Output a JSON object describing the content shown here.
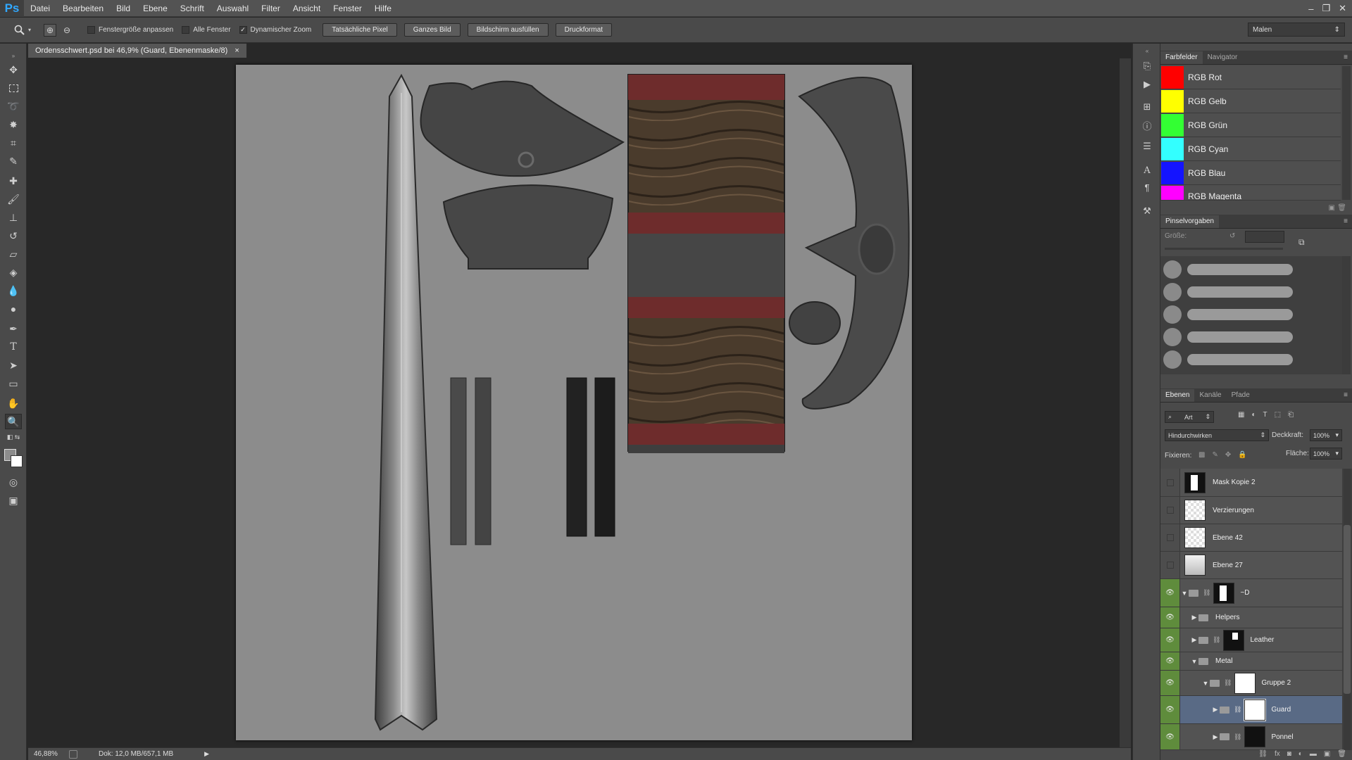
{
  "app": {
    "logo": "Ps"
  },
  "menu": [
    "Datei",
    "Bearbeiten",
    "Bild",
    "Ebene",
    "Schrift",
    "Auswahl",
    "Filter",
    "Ansicht",
    "Fenster",
    "Hilfe"
  ],
  "window_controls": {
    "minimize": "–",
    "restore": "❐",
    "close": "✕"
  },
  "options": {
    "fit_window": "Fenstergröße anpassen",
    "fit_window_checked": false,
    "all_windows": "Alle Fenster",
    "all_windows_checked": false,
    "dynamic_zoom": "Dynamischer Zoom",
    "dynamic_zoom_checked": true,
    "btn_actual": "Tatsächliche Pixel",
    "btn_fit": "Ganzes Bild",
    "btn_fill": "Bildschirm ausfüllen",
    "btn_print": "Druckformat",
    "workspace": "Malen"
  },
  "document": {
    "tab_title": "Ordensschwert.psd bei 46,9% (Guard, Ebenenmaske/8)",
    "close": "×"
  },
  "status": {
    "zoom": "46,88%",
    "doc": "Dok: 12,0 MB/657,1 MB"
  },
  "swatches_panel": {
    "tabs": [
      "Farbfelder",
      "Navigator"
    ],
    "items": [
      {
        "name": "RGB Rot",
        "color": "#ff0000"
      },
      {
        "name": "RGB Gelb",
        "color": "#ffff00"
      },
      {
        "name": "RGB Grün",
        "color": "#33ff33"
      },
      {
        "name": "RGB Cyan",
        "color": "#33ffff"
      },
      {
        "name": "RGB Blau",
        "color": "#1414ff"
      },
      {
        "name": "RGB Magenta",
        "color": "#ff00ff"
      }
    ]
  },
  "brush_panel": {
    "tab": "Pinselvorgaben",
    "size_label": "Größe:"
  },
  "layers_panel": {
    "tabs": [
      "Ebenen",
      "Kanäle",
      "Pfade"
    ],
    "filter": "Art",
    "blend_mode": "Hindurchwirken",
    "opacity_label": "Deckkraft:",
    "opacity": "100%",
    "lock_label": "Fixieren:",
    "fill_label": "Fläche:",
    "fill": "100%",
    "layers": [
      {
        "name": "Mask Kopie 2",
        "visible": false
      },
      {
        "name": "Verzierungen",
        "visible": false
      },
      {
        "name": "Ebene 42",
        "visible": false
      },
      {
        "name": "Ebene 27",
        "visible": false
      },
      {
        "name": "~D",
        "visible": true
      },
      {
        "name": "Helpers",
        "visible": true
      },
      {
        "name": "Leather",
        "visible": true
      },
      {
        "name": "Metal",
        "visible": true
      },
      {
        "name": "Gruppe 2",
        "visible": true
      },
      {
        "name": "Guard",
        "visible": true,
        "selected": true
      },
      {
        "name": "Ponnel",
        "visible": true
      }
    ]
  }
}
